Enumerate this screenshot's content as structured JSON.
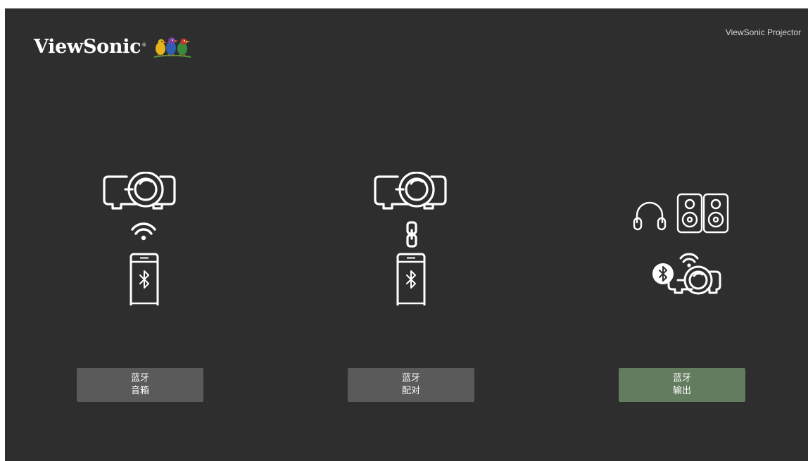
{
  "header": {
    "brand": "ViewSonic",
    "brand_mark": "®",
    "product_label": "ViewSonic Projector"
  },
  "options": [
    {
      "line1": "蓝牙",
      "line2": "音箱",
      "icon": "projector-wifi-phone-bluetooth",
      "selected": false
    },
    {
      "line1": "蓝牙",
      "line2": "配对",
      "icon": "projector-link-phone-bluetooth",
      "selected": false
    },
    {
      "line1": "蓝牙",
      "line2": "输出",
      "icon": "headphones-speakers-projector-bluetooth",
      "selected": true
    }
  ],
  "colors": {
    "background": "#2d2e2d",
    "button": "#5a5a5a",
    "button_selected": "#637b5e",
    "icon": "#ffffff"
  }
}
